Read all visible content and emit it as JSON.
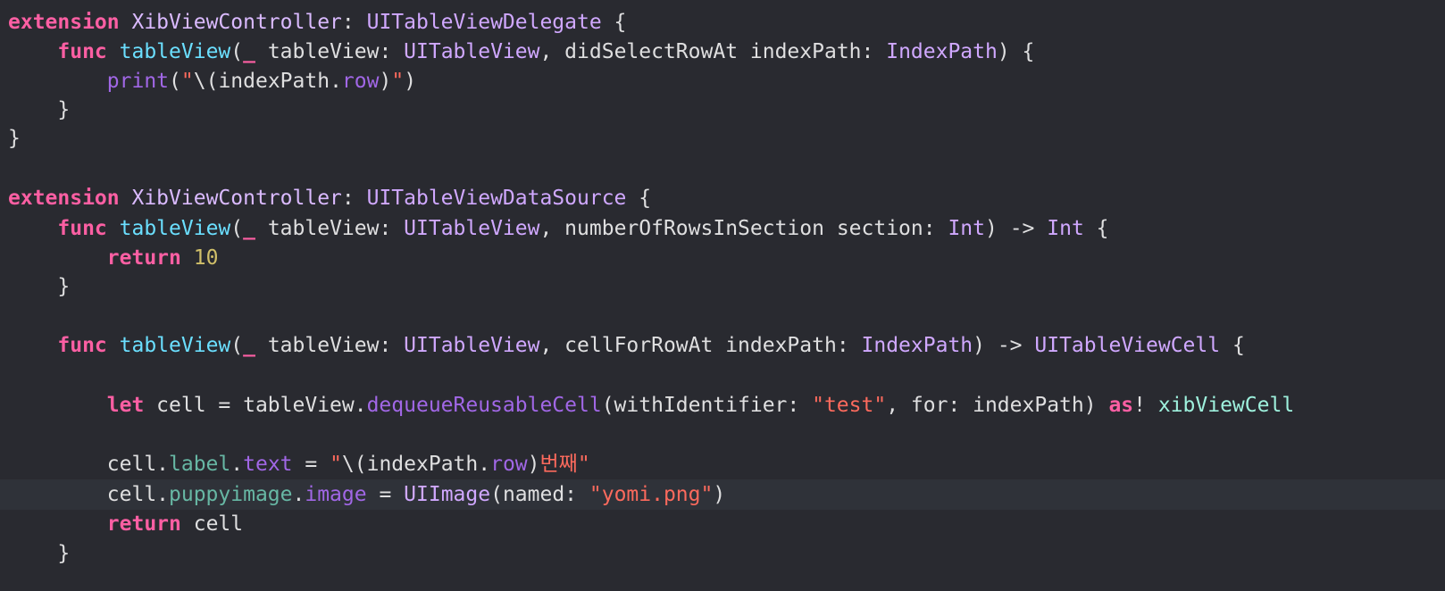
{
  "colors": {
    "background": "#292a30",
    "current_line": "#2f3239",
    "keyword": "#fc5fa3",
    "type_declaration": "#dabaff",
    "type_reference": "#d0a8ff",
    "function_declaration": "#6bdfff",
    "other_type": "#9ef1dd",
    "string": "#fc6a5d",
    "number": "#d0bf69",
    "property": "#67b7a4",
    "member": "#a167e6",
    "plain_text": "#dfdfe0"
  },
  "code": {
    "lines": [
      [
        {
          "t": "extension",
          "c": "kw"
        },
        {
          "t": " ",
          "c": "plain"
        },
        {
          "t": "XibViewController",
          "c": "decl"
        },
        {
          "t": ": ",
          "c": "plain"
        },
        {
          "t": "UITableViewDelegate",
          "c": "type"
        },
        {
          "t": " {",
          "c": "plain"
        }
      ],
      [
        {
          "t": "    ",
          "c": "plain"
        },
        {
          "t": "func",
          "c": "kw"
        },
        {
          "t": " ",
          "c": "plain"
        },
        {
          "t": "tableView",
          "c": "fn"
        },
        {
          "t": "(",
          "c": "plain"
        },
        {
          "t": "_",
          "c": "kw"
        },
        {
          "t": " tableView: ",
          "c": "plain"
        },
        {
          "t": "UITableView",
          "c": "type"
        },
        {
          "t": ", didSelectRowAt indexPath: ",
          "c": "plain"
        },
        {
          "t": "IndexPath",
          "c": "type"
        },
        {
          "t": ") {",
          "c": "plain"
        }
      ],
      [
        {
          "t": "        ",
          "c": "plain"
        },
        {
          "t": "print",
          "c": "bfn"
        },
        {
          "t": "(",
          "c": "plain"
        },
        {
          "t": "\"",
          "c": "str"
        },
        {
          "t": "\\(indexPath.",
          "c": "plain"
        },
        {
          "t": "row",
          "c": "mem"
        },
        {
          "t": ")",
          "c": "plain"
        },
        {
          "t": "\"",
          "c": "str"
        },
        {
          "t": ")",
          "c": "plain"
        }
      ],
      [
        {
          "t": "    }",
          "c": "plain"
        }
      ],
      [
        {
          "t": "}",
          "c": "plain"
        }
      ],
      [],
      [
        {
          "t": "extension",
          "c": "kw"
        },
        {
          "t": " ",
          "c": "plain"
        },
        {
          "t": "XibViewController",
          "c": "decl"
        },
        {
          "t": ": ",
          "c": "plain"
        },
        {
          "t": "UITableViewDataSource",
          "c": "type"
        },
        {
          "t": " {",
          "c": "plain"
        }
      ],
      [
        {
          "t": "    ",
          "c": "plain"
        },
        {
          "t": "func",
          "c": "kw"
        },
        {
          "t": " ",
          "c": "plain"
        },
        {
          "t": "tableView",
          "c": "fn"
        },
        {
          "t": "(",
          "c": "plain"
        },
        {
          "t": "_",
          "c": "kw"
        },
        {
          "t": " tableView: ",
          "c": "plain"
        },
        {
          "t": "UITableView",
          "c": "type"
        },
        {
          "t": ", numberOfRowsInSection section: ",
          "c": "plain"
        },
        {
          "t": "Int",
          "c": "type"
        },
        {
          "t": ") -> ",
          "c": "plain"
        },
        {
          "t": "Int",
          "c": "type"
        },
        {
          "t": " {",
          "c": "plain"
        }
      ],
      [
        {
          "t": "        ",
          "c": "plain"
        },
        {
          "t": "return",
          "c": "kw"
        },
        {
          "t": " ",
          "c": "plain"
        },
        {
          "t": "10",
          "c": "num"
        }
      ],
      [
        {
          "t": "    }",
          "c": "plain"
        }
      ],
      [],
      [
        {
          "t": "    ",
          "c": "plain"
        },
        {
          "t": "func",
          "c": "kw"
        },
        {
          "t": " ",
          "c": "plain"
        },
        {
          "t": "tableView",
          "c": "fn"
        },
        {
          "t": "(",
          "c": "plain"
        },
        {
          "t": "_",
          "c": "kw"
        },
        {
          "t": " tableView: ",
          "c": "plain"
        },
        {
          "t": "UITableView",
          "c": "type"
        },
        {
          "t": ", cellForRowAt indexPath: ",
          "c": "plain"
        },
        {
          "t": "IndexPath",
          "c": "type"
        },
        {
          "t": ") -> ",
          "c": "plain"
        },
        {
          "t": "UITableViewCell",
          "c": "type"
        },
        {
          "t": " {",
          "c": "plain"
        }
      ],
      [],
      [
        {
          "t": "        ",
          "c": "plain"
        },
        {
          "t": "let",
          "c": "kw"
        },
        {
          "t": " cell = tableView.",
          "c": "plain"
        },
        {
          "t": "dequeueReusableCell",
          "c": "mem"
        },
        {
          "t": "(withIdentifier: ",
          "c": "plain"
        },
        {
          "t": "\"test\"",
          "c": "str"
        },
        {
          "t": ", for: indexPath) ",
          "c": "plain"
        },
        {
          "t": "as",
          "c": "kw"
        },
        {
          "t": "! ",
          "c": "plain"
        },
        {
          "t": "xibViewCell",
          "c": "typeuse"
        }
      ],
      [],
      [
        {
          "t": "        cell.",
          "c": "plain"
        },
        {
          "t": "label",
          "c": "prop"
        },
        {
          "t": ".",
          "c": "plain"
        },
        {
          "t": "text",
          "c": "mem"
        },
        {
          "t": " = ",
          "c": "plain"
        },
        {
          "t": "\"",
          "c": "str"
        },
        {
          "t": "\\(indexPath.",
          "c": "plain"
        },
        {
          "t": "row",
          "c": "mem"
        },
        {
          "t": ")",
          "c": "plain"
        },
        {
          "t": "번째\"",
          "c": "str"
        }
      ],
      [
        {
          "t": "        cell.",
          "c": "plain"
        },
        {
          "t": "puppyimage",
          "c": "prop"
        },
        {
          "t": ".",
          "c": "plain"
        },
        {
          "t": "image",
          "c": "mem"
        },
        {
          "t": " = ",
          "c": "plain"
        },
        {
          "t": "UIImage",
          "c": "type"
        },
        {
          "t": "(named: ",
          "c": "plain"
        },
        {
          "t": "\"yomi.png\"",
          "c": "str"
        },
        {
          "t": ")",
          "c": "plain"
        }
      ],
      [
        {
          "t": "        ",
          "c": "plain"
        },
        {
          "t": "return",
          "c": "kw"
        },
        {
          "t": " cell",
          "c": "plain"
        }
      ],
      [
        {
          "t": "    }",
          "c": "plain"
        }
      ]
    ],
    "current_line_index": 16
  }
}
